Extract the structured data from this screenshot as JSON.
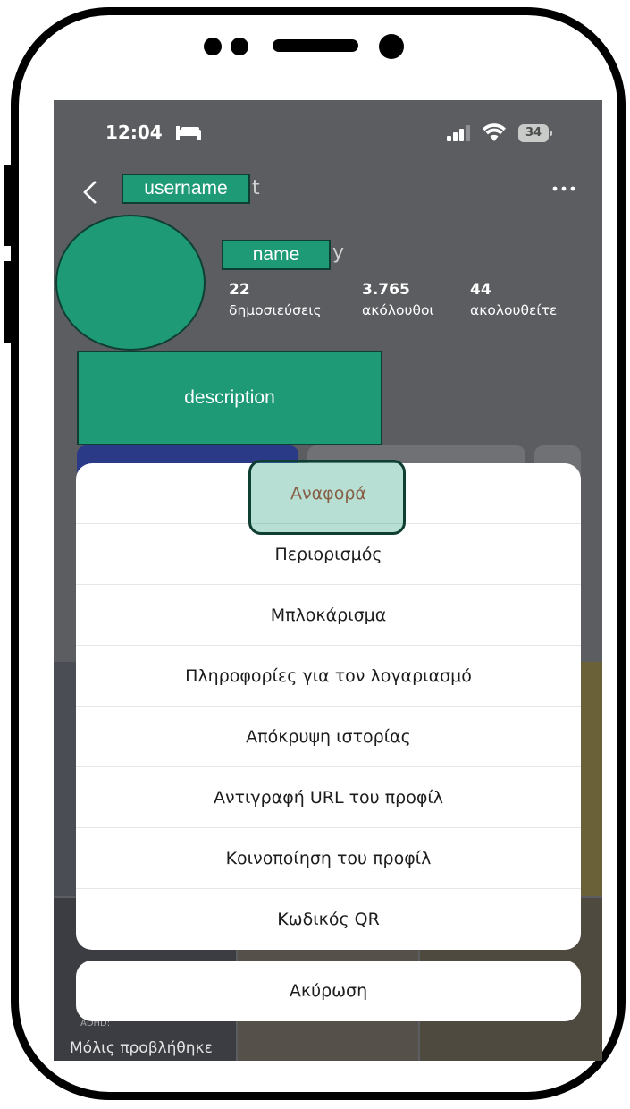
{
  "status_bar": {
    "time": "12:04",
    "battery": "34"
  },
  "header": {
    "username_tag": "username",
    "name_tag": "name"
  },
  "stats": [
    {
      "value": "22",
      "label": "δημοσιεύσεις"
    },
    {
      "value": "3.765",
      "label": "ακόλουθοι"
    },
    {
      "value": "44",
      "label": "ακολουθείτε"
    }
  ],
  "description_tag": "description",
  "action_sheet": {
    "items": [
      {
        "label": "Αναφορά",
        "style": "destructive"
      },
      {
        "label": "Περιορισμός"
      },
      {
        "label": "Μπλοκάρισμα"
      },
      {
        "label": "Πληροφορίες για τον λογαριασμό"
      },
      {
        "label": "Απόκρυψη ιστορίας"
      },
      {
        "label": "Αντιγραφή URL του προφίλ"
      },
      {
        "label": "Κοινοποίηση του προφίλ"
      },
      {
        "label": "Κωδικός QR"
      }
    ],
    "cancel_label": "Ακύρωση"
  },
  "background_caption": "Μόλις προβλήθηκε",
  "colors": {
    "tag_fill": "#1e9a77",
    "tag_border": "#0f3f32",
    "destructive_text": "#b94331",
    "dim_overlay": "#5b5d60"
  }
}
